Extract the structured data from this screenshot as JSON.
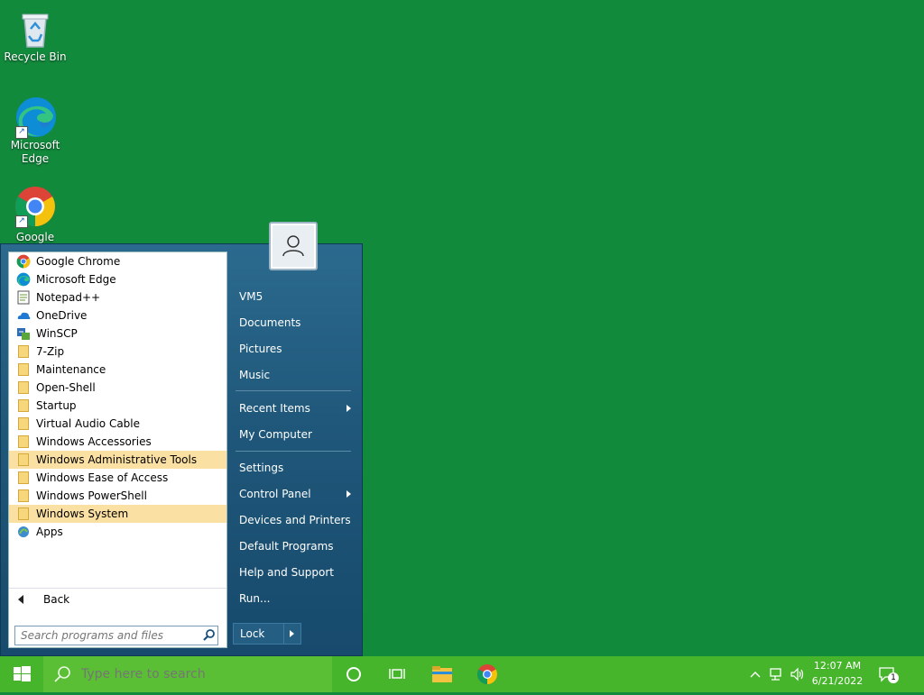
{
  "desktop": {
    "icons": [
      {
        "label": "Recycle Bin"
      },
      {
        "label": "Microsoft Edge"
      },
      {
        "label": "Google"
      }
    ]
  },
  "start_menu": {
    "programs": [
      {
        "label": "Google Chrome",
        "icon": "chrome-icon"
      },
      {
        "label": "Microsoft Edge",
        "icon": "edge-icon"
      },
      {
        "label": "Notepad++",
        "icon": "notepad-icon"
      },
      {
        "label": "OneDrive",
        "icon": "onedrive-icon"
      },
      {
        "label": "WinSCP",
        "icon": "winscp-icon"
      },
      {
        "label": "7-Zip",
        "icon": "folder-icon"
      },
      {
        "label": "Maintenance",
        "icon": "folder-icon"
      },
      {
        "label": "Open-Shell",
        "icon": "folder-icon"
      },
      {
        "label": "Startup",
        "icon": "folder-icon"
      },
      {
        "label": "Virtual Audio Cable",
        "icon": "folder-icon"
      },
      {
        "label": "Windows Accessories",
        "icon": "folder-icon"
      },
      {
        "label": "Windows Administrative Tools",
        "icon": "folder-icon"
      },
      {
        "label": "Windows Ease of Access",
        "icon": "folder-icon"
      },
      {
        "label": "Windows PowerShell",
        "icon": "folder-icon"
      },
      {
        "label": "Windows System",
        "icon": "folder-icon"
      },
      {
        "label": "Apps",
        "icon": "apps-icon"
      }
    ],
    "back_label": "Back",
    "search_placeholder": "Search programs and files",
    "right_items": [
      {
        "label": "VM5",
        "submenu": false
      },
      {
        "label": "Documents",
        "submenu": false
      },
      {
        "label": "Pictures",
        "submenu": false
      },
      {
        "label": "Music",
        "submenu": false
      },
      {
        "label": "Recent Items",
        "submenu": true
      },
      {
        "label": "My Computer",
        "submenu": false
      },
      {
        "label": "Settings",
        "submenu": false
      },
      {
        "label": "Control Panel",
        "submenu": true
      },
      {
        "label": "Devices and Printers",
        "submenu": false
      },
      {
        "label": "Default Programs",
        "submenu": false
      },
      {
        "label": "Help and Support",
        "submenu": false
      },
      {
        "label": "Run...",
        "submenu": false
      }
    ],
    "lock_label": "Lock"
  },
  "taskbar": {
    "search_placeholder": "Type here to search",
    "time": "12:07 AM",
    "date": "6/21/2022",
    "notification_count": "1"
  },
  "colors": {
    "desktop": "#128a3c",
    "taskbar": "#47b52b",
    "highlight": "#fbe0a3"
  }
}
